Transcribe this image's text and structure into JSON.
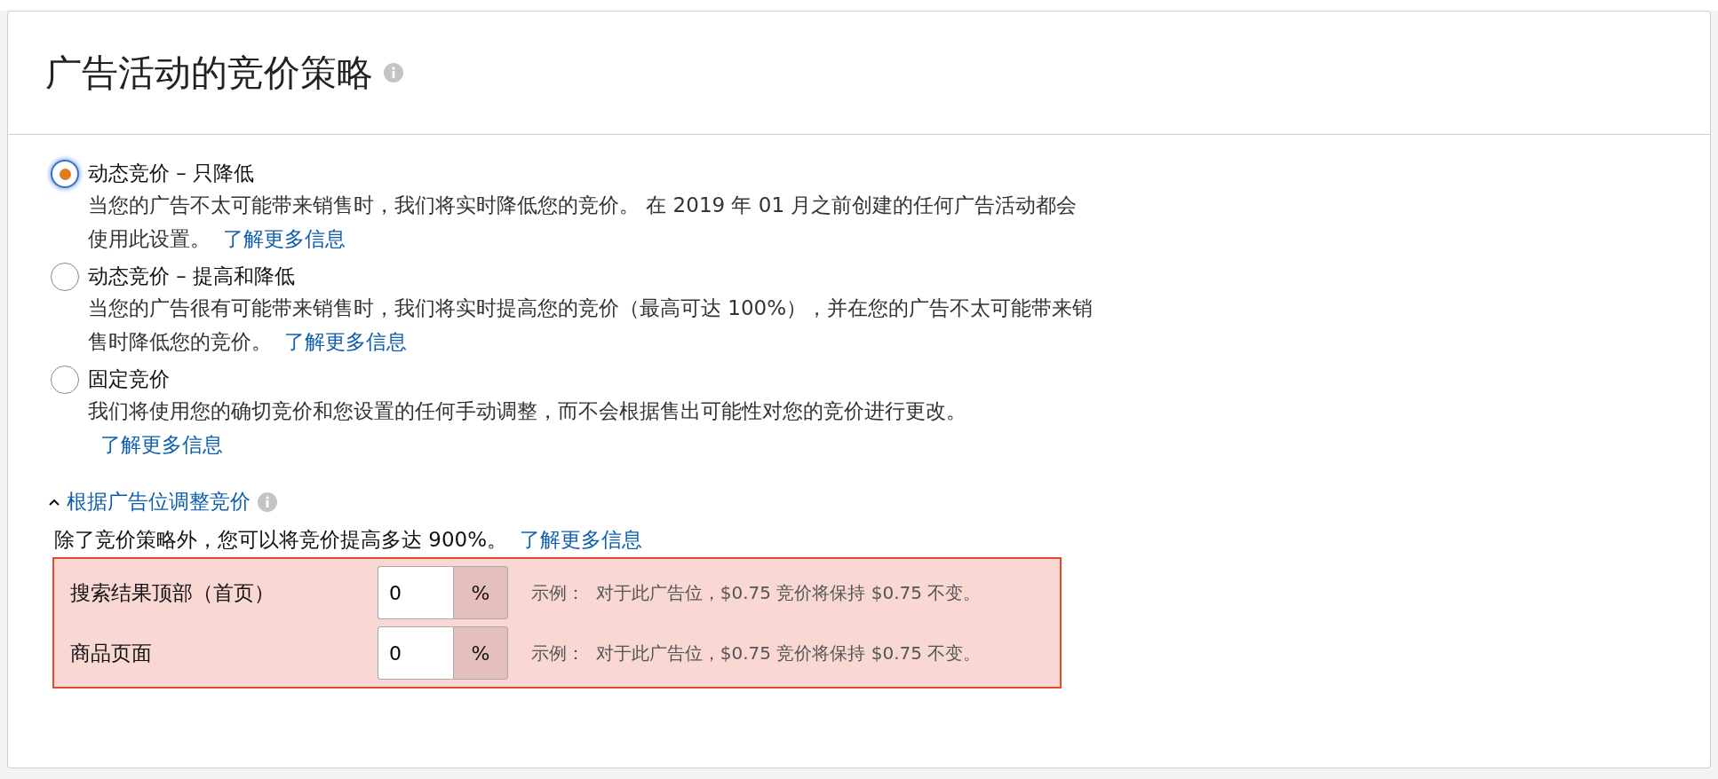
{
  "header": {
    "title": "广告活动的竞价策略"
  },
  "strategies": [
    {
      "label": "动态竞价 – 只降低",
      "selected": true,
      "description": "当您的广告不太可能带来销售时，我们将实时降低您的竞价。 在 2019 年 01 月之前创建的任何广告活动都会使用此设置。",
      "link": "了解更多信息"
    },
    {
      "label": "动态竞价 – 提高和降低",
      "selected": false,
      "description": "当您的广告很有可能带来销售时，我们将实时提高您的竞价（最高可达 100%），并在您的广告不太可能带来销售时降低您的竞价。",
      "link": "了解更多信息"
    },
    {
      "label": "固定竞价",
      "selected": false,
      "description": "我们将使用您的确切竞价和您设置的任何手动调整，而不会根据售出可能性对您的竞价进行更改。",
      "link": "了解更多信息"
    }
  ],
  "placement": {
    "toggle": "根据广告位调整竞价",
    "expanded": true,
    "intro": "除了竞价策略外，您可以将竞价提高多达 900%。",
    "link": "了解更多信息",
    "highlighted": true,
    "rows": [
      {
        "label": "搜索结果顶部（首页）",
        "value": "0",
        "unit": "%",
        "example": "示例：  对于此广告位，$0.75 竞价将保持 $0.75 不变。"
      },
      {
        "label": "商品页面",
        "value": "0",
        "unit": "%",
        "example": "示例：  对于此广告位，$0.75 竞价将保持 $0.75 不变。"
      }
    ]
  }
}
